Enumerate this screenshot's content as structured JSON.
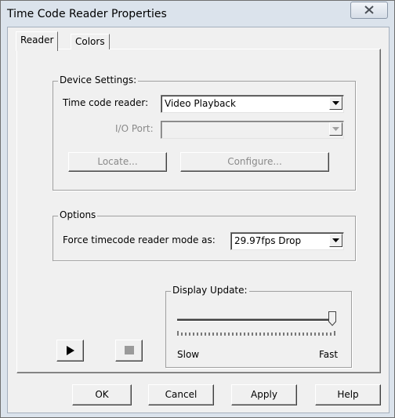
{
  "window": {
    "title": "Time Code Reader Properties"
  },
  "tabs": [
    {
      "label": "Reader",
      "active": true
    },
    {
      "label": "Colors",
      "active": false
    }
  ],
  "device_settings": {
    "group_label": "Device Settings:",
    "time_code_reader_label": "Time code reader:",
    "time_code_reader_value": "Video Playback",
    "io_port_label": "I/O Port:",
    "io_port_value": "",
    "locate_label": "Locate...",
    "configure_label": "Configure..."
  },
  "options": {
    "group_label": "Options",
    "force_mode_label": "Force timecode reader mode as:",
    "force_mode_value": "29.97fps Drop"
  },
  "display_update": {
    "group_label": "Display Update:",
    "slow_label": "Slow",
    "fast_label": "Fast",
    "slider_value_fraction": 1.0
  },
  "transport": {
    "play_icon": "play-icon",
    "stop_icon": "stop-icon"
  },
  "footer": {
    "ok_label": "OK",
    "cancel_label": "Cancel",
    "apply_label": "Apply",
    "help_label": "Help"
  },
  "icons": {
    "close": "close-icon",
    "dropdown": "chevron-down-icon"
  }
}
